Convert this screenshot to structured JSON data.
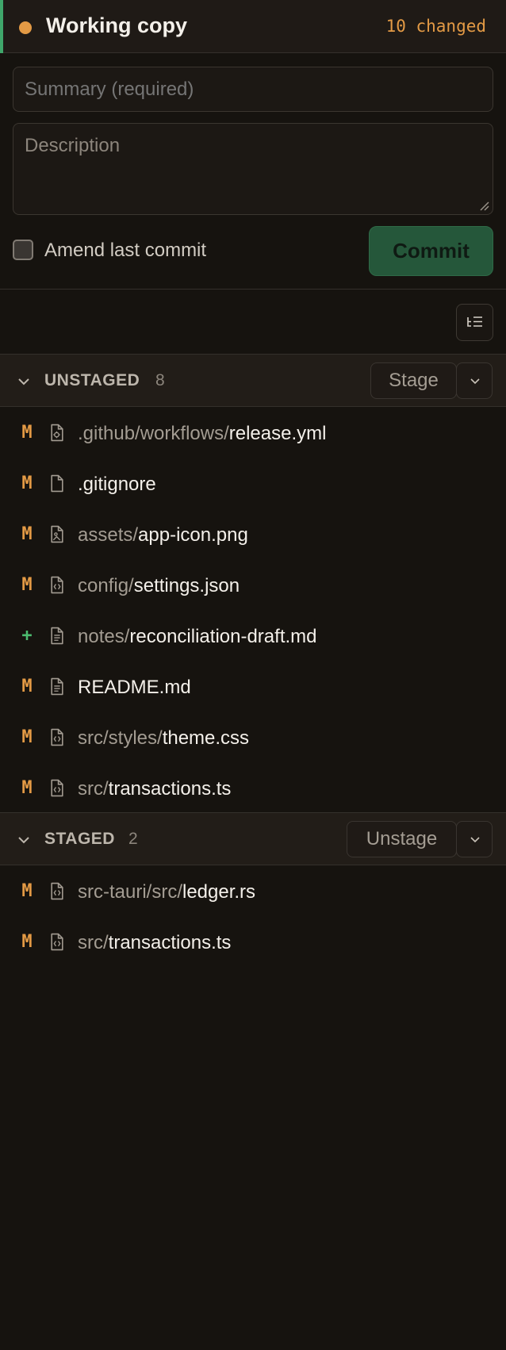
{
  "header": {
    "title": "Working copy",
    "changed": "10 changed"
  },
  "commit_form": {
    "summary_placeholder": "Summary (required)",
    "description_placeholder": "Description",
    "amend_label": "Amend last commit",
    "commit_label": "Commit"
  },
  "unstaged": {
    "title": "UNSTAGED",
    "count": "8",
    "action_label": "Stage",
    "files": [
      {
        "status": "M",
        "dir": ".github/workflows/",
        "name": "release.yml",
        "icon": "config-file-icon"
      },
      {
        "status": "M",
        "dir": "",
        "name": ".gitignore",
        "icon": "file-icon"
      },
      {
        "status": "M",
        "dir": "assets/",
        "name": "app-icon.png",
        "icon": "image-file-icon"
      },
      {
        "status": "M",
        "dir": "config/",
        "name": "settings.json",
        "icon": "code-file-icon"
      },
      {
        "status": "+",
        "dir": "notes/",
        "name": "reconciliation-draft.md",
        "icon": "text-file-icon"
      },
      {
        "status": "M",
        "dir": "",
        "name": "README.md",
        "icon": "text-file-icon"
      },
      {
        "status": "M",
        "dir": "src/styles/",
        "name": "theme.css",
        "icon": "code-file-icon"
      },
      {
        "status": "M",
        "dir": "src/",
        "name": "transactions.ts",
        "icon": "code-file-icon"
      }
    ]
  },
  "staged": {
    "title": "STAGED",
    "count": "2",
    "action_label": "Unstage",
    "files": [
      {
        "status": "M",
        "dir": "src-tauri/src/",
        "name": "ledger.rs",
        "icon": "code-file-icon"
      },
      {
        "status": "M",
        "dir": "src/",
        "name": "transactions.ts",
        "icon": "code-file-icon"
      }
    ]
  },
  "colors": {
    "modified": "#e39a45",
    "added": "#4cbc6f",
    "accent": "#3fa66a",
    "commit_button": "#25573a"
  }
}
